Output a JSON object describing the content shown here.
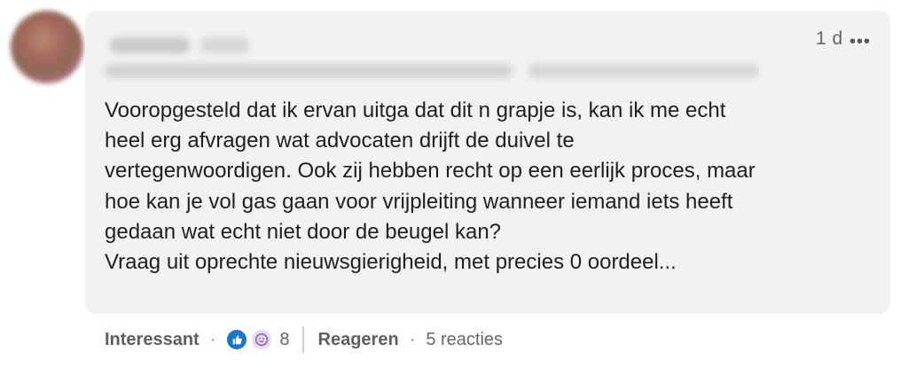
{
  "comment": {
    "timestamp": "1 d",
    "more_icon": "•••",
    "lines": [
      "Vooropgesteld dat ik ervan uitga dat dit n grapje is, kan ik me echt",
      "heel erg afvragen wat advocaten drijft de duivel te",
      "vertegenwoordigen. Ook zij hebben recht op een eerlijk proces, maar",
      "hoe kan je vol gas gaan voor vrijpleiting wanneer iemand iets heeft",
      "gedaan wat echt niet door de beugel kan?",
      "Vraag uit oprechte nieuwsgierigheid, met precies 0 oordeel..."
    ]
  },
  "actions": {
    "react_label": "Interessant",
    "dot": "·",
    "reaction_count": "8",
    "reply_label": "Reageren",
    "replies_label": "5 reacties",
    "reaction_icons": [
      "like-icon",
      "funny-icon"
    ],
    "colors": {
      "like": "#1b76c8",
      "funny": "#e7dbf2"
    }
  }
}
